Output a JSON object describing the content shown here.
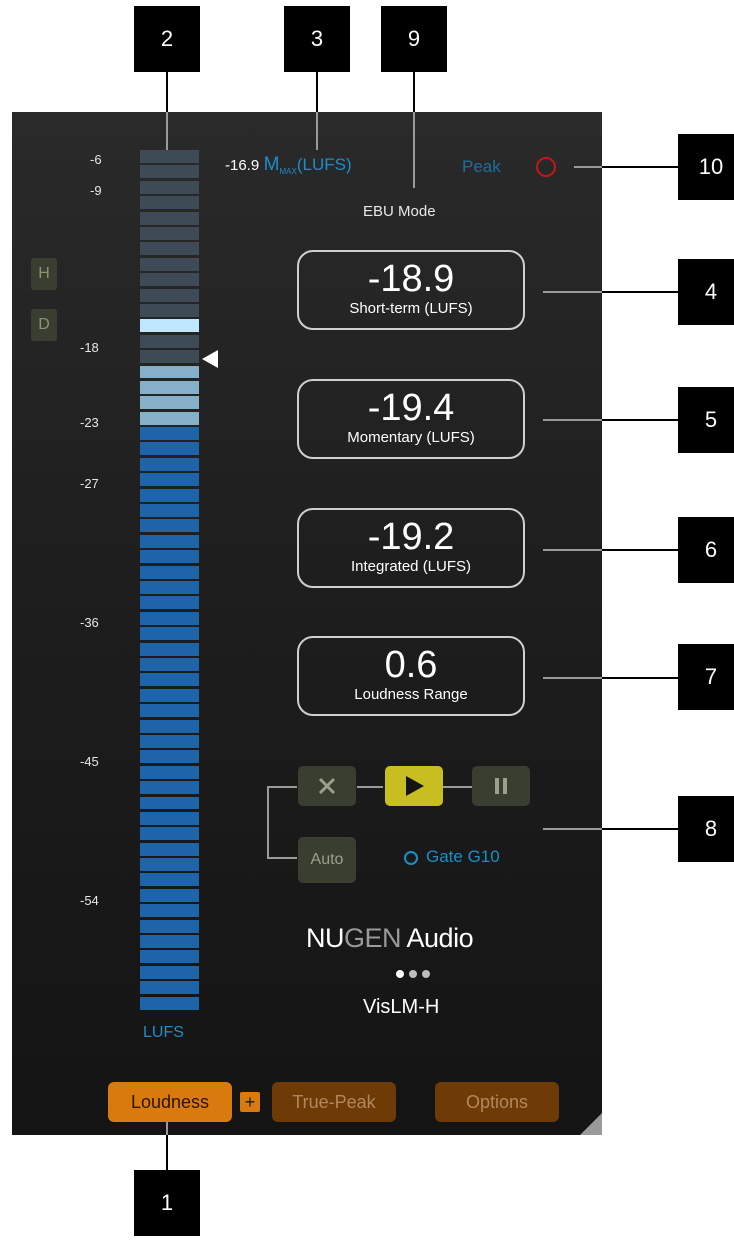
{
  "callouts": [
    "1",
    "2",
    "3",
    "4",
    "5",
    "6",
    "7",
    "8",
    "9",
    "10"
  ],
  "meter": {
    "scale_labels": [
      "-6",
      "-9",
      "-18",
      "-23",
      "-27",
      "-36",
      "-45",
      "-54"
    ],
    "unit_label": "LUFS",
    "colors": {
      "off": "#3e4a55",
      "on_blue": "#1d64a8",
      "light": "#86b0c9",
      "highlight": "#bfe6ff"
    }
  },
  "side_buttons": {
    "h_label": "H",
    "d_label": "D"
  },
  "max_readout": {
    "value": "-16.9",
    "m_label": "M",
    "max_sub": "MAX",
    "unit": "(LUFS)"
  },
  "ebu_mode": "EBU Mode",
  "peak": {
    "label": "Peak"
  },
  "readouts": [
    {
      "value": "-18.9",
      "label": "Short-term (LUFS)"
    },
    {
      "value": "-19.4",
      "label": "Momentary (LUFS)"
    },
    {
      "value": "-19.2",
      "label": "Integrated (LUFS)"
    },
    {
      "value": "0.6",
      "label": "Loudness Range"
    }
  ],
  "transport": {
    "reset_icon": "close-icon",
    "play_icon": "play-icon",
    "pause_icon": "pause-icon",
    "auto_label": "Auto",
    "gate_label": "Gate G10"
  },
  "brand": {
    "nu": "NU",
    "gen": "GEN",
    "audio": " Audio",
    "product": "VisLM-H"
  },
  "bottom_buttons": {
    "loudness": "Loudness",
    "plus": "+",
    "true_peak": "True-Peak",
    "options": "Options"
  },
  "accent_colors": {
    "cyan": "#1c8ec8",
    "orange": "#d97a0f",
    "dark_orange": "#6e3b07",
    "olive": "#c8be22",
    "peak_red": "#c01818"
  }
}
